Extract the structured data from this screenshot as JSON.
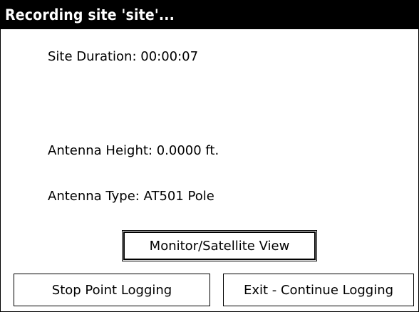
{
  "window": {
    "title": "Recording site 'site'..."
  },
  "info": {
    "site_duration": "Site Duration: 00:00:07",
    "antenna_height": "Antenna Height: 0.0000 ft.",
    "antenna_type": "Antenna Type: AT501 Pole"
  },
  "buttons": {
    "monitor_label": "Monitor/Satellite View",
    "stop_label": "Stop Point Logging",
    "exit_label": "Exit - Continue Logging"
  },
  "colors": {
    "titlebar_bg": "#000000",
    "titlebar_text": "#ffffff",
    "background": "#ffffff",
    "text": "#000000"
  }
}
